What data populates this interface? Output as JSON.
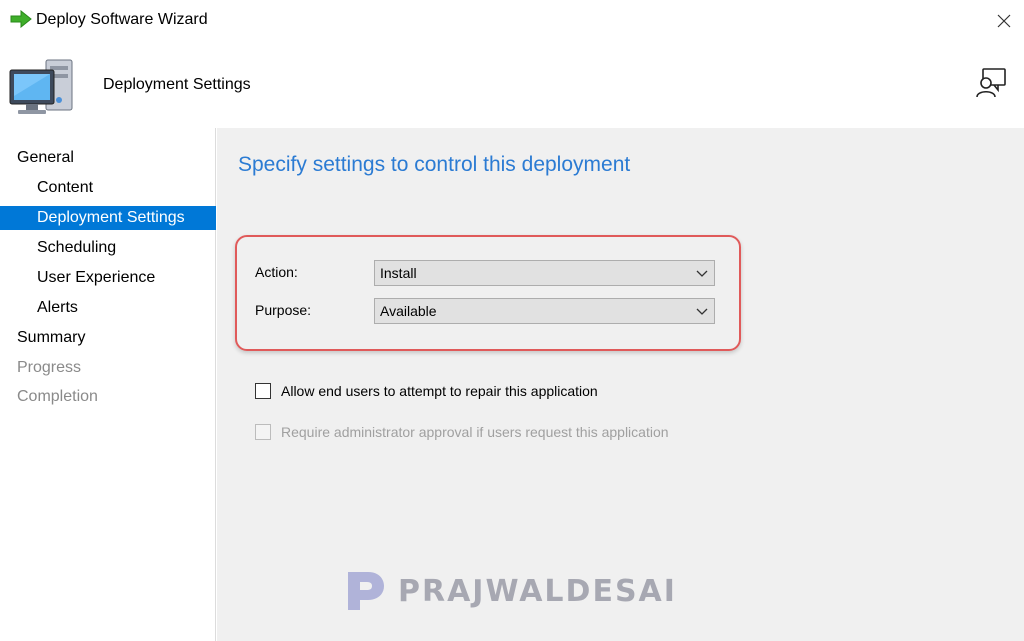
{
  "window": {
    "title": "Deploy Software Wizard",
    "icons": {
      "title": "green-arrow-icon",
      "close": "close-icon"
    }
  },
  "header": {
    "title": "Deployment Settings",
    "icons": {
      "page": "computer-icon",
      "feedback": "feedback-icon"
    }
  },
  "sidebar": {
    "items": [
      {
        "label": "General",
        "level": "top",
        "state": "normal"
      },
      {
        "label": "Content",
        "level": "child",
        "state": "normal"
      },
      {
        "label": "Deployment Settings",
        "level": "child",
        "state": "selected"
      },
      {
        "label": "Scheduling",
        "level": "child",
        "state": "normal"
      },
      {
        "label": "User Experience",
        "level": "child",
        "state": "normal"
      },
      {
        "label": "Alerts",
        "level": "child",
        "state": "normal"
      },
      {
        "label": "Summary",
        "level": "top",
        "state": "normal"
      },
      {
        "label": "Progress",
        "level": "top",
        "state": "disabled"
      },
      {
        "label": "Completion",
        "level": "top",
        "state": "disabled"
      }
    ]
  },
  "main": {
    "heading": "Specify settings to control this deployment",
    "action": {
      "label": "Action:",
      "value": "Install"
    },
    "purpose": {
      "label": "Purpose:",
      "value": "Available"
    },
    "repair_checkbox": {
      "label": "Allow end users to attempt to repair this application",
      "checked": false,
      "enabled": true
    },
    "approval_checkbox": {
      "label": "Require administrator approval if users request this application",
      "checked": false,
      "enabled": false
    }
  },
  "watermark": {
    "text": "PRAJWALDESAI"
  },
  "colors": {
    "accent": "#0078d7",
    "heading": "#2b7bd3",
    "highlight": "#e05a5a",
    "panel": "#f0f0f0",
    "disabled_text": "#8a8a8a"
  }
}
